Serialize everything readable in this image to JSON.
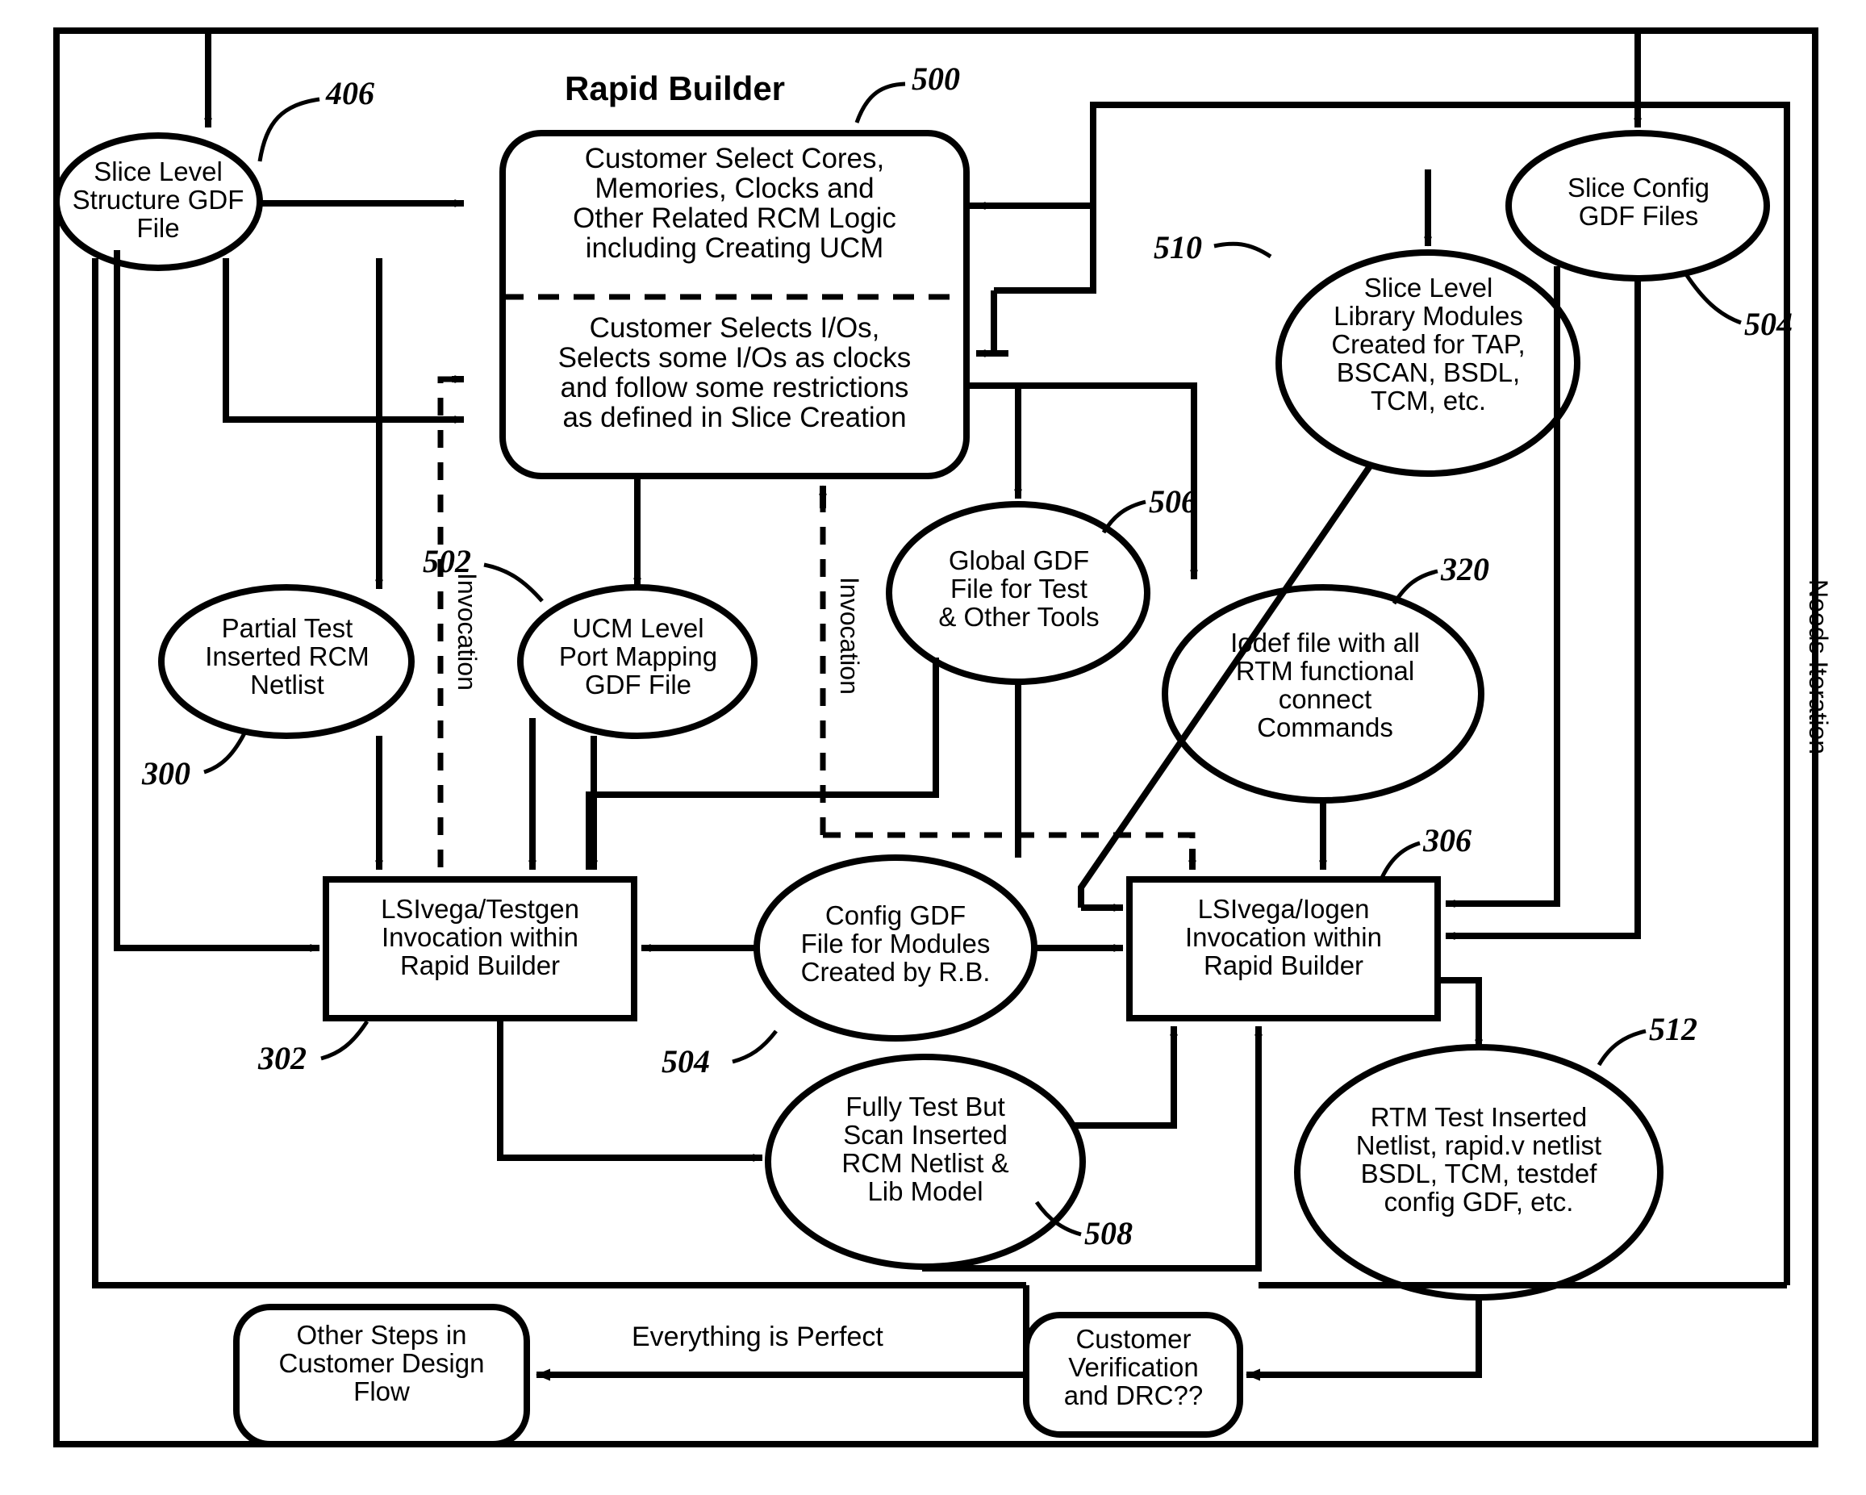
{
  "figure": {
    "title": "Rapid Builder",
    "frame_label": "Needs Iteration"
  },
  "nodes": {
    "slice_level_structure_gdf": {
      "text": "Slice Level\nStructure GDF\nFile",
      "ref": "406"
    },
    "rapid_builder_box_top": {
      "text": "Customer Select Cores,\nMemories, Clocks and\nOther Related RCM Logic\nincluding Creating UCM",
      "ref": "500"
    },
    "rapid_builder_box_bottom": {
      "text": "Customer Selects I/Os,\nSelects some I/Os as clocks\nand follow some restrictions\nas defined in Slice Creation"
    },
    "slice_level_library_modules": {
      "text": "Slice Level\nLibrary Modules\nCreated for TAP,\nBSCAN, BSDL,\nTCM, etc.",
      "ref": "510"
    },
    "slice_config_gdf_files": {
      "text": "Slice Config\nGDF Files",
      "ref": "504"
    },
    "partial_test_inserted_rcm_netlist": {
      "text": "Partial Test\nInserted RCM\nNetlist",
      "ref": "300"
    },
    "ucm_level_port_mapping_gdf_file": {
      "text": "UCM Level\nPort Mapping\nGDF File",
      "ref": "502"
    },
    "global_gdf_file": {
      "text": "Global GDF\nFile for Test\n& Other Tools",
      "ref": "506"
    },
    "iodef_file": {
      "text": "Iodef file with all\nRTM functional\nconnect\nCommands",
      "ref": "320"
    },
    "lsivega_testgen": {
      "text": "LSIvega/Testgen\nInvocation within\nRapid Builder",
      "ref": "302"
    },
    "config_gdf_file_modules": {
      "text": "Config GDF\nFile for Modules\nCreated by R.B.",
      "ref": "504"
    },
    "lsivega_iogen": {
      "text": "LSIvega/Iogen\nInvocation within\nRapid Builder",
      "ref": "306"
    },
    "fully_test_but_scan_inserted": {
      "text": "Fully Test But\nScan Inserted\nRCM Netlist &\nLib Model",
      "ref": "508"
    },
    "rtm_test_inserted_netlist": {
      "text": "RTM Test Inserted\nNetlist, rapid.v netlist\nBSDL, TCM, testdef\nconfig GDF, etc.",
      "ref": "512"
    },
    "customer_verification": {
      "text": "Customer\nVerification\nand DRC??"
    },
    "other_steps_customer_design_flow": {
      "text": "Other Steps in\nCustomer Design\nFlow"
    }
  },
  "edge_labels": {
    "everything_is_perfect": "Everything is Perfect",
    "invocation_1": "Invocation",
    "invocation_2": "Invocation"
  },
  "colors": {
    "line": "#000000",
    "background": "#ffffff"
  }
}
